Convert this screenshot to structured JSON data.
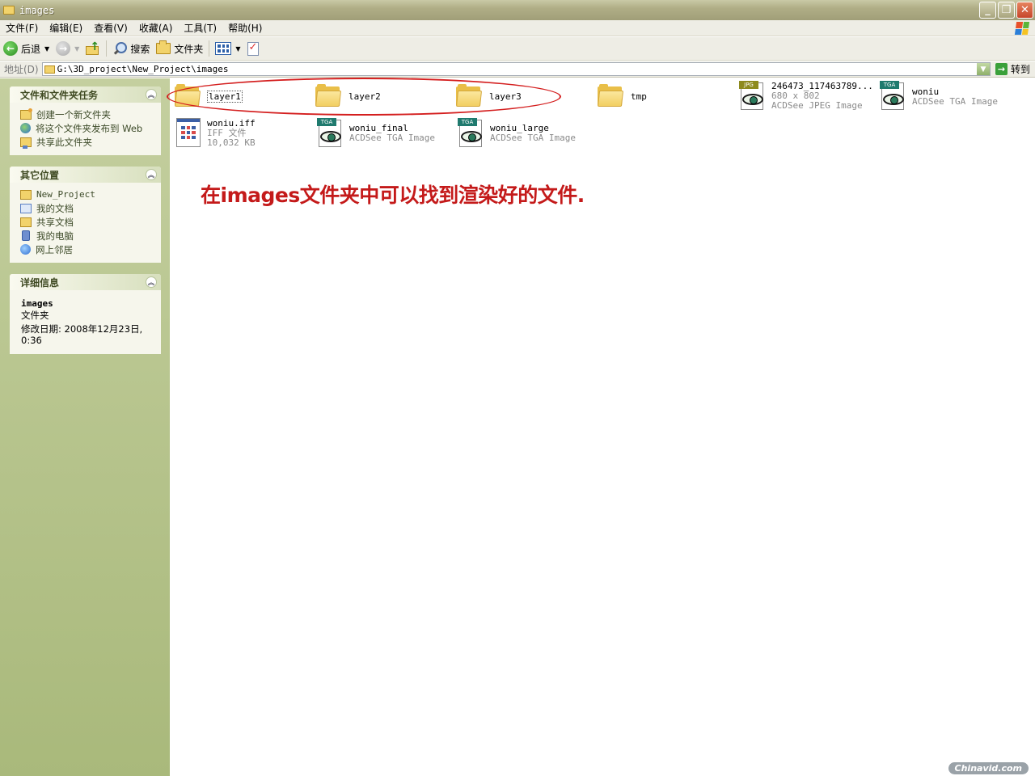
{
  "window": {
    "title": "images"
  },
  "menu": [
    "文件(F)",
    "编辑(E)",
    "查看(V)",
    "收藏(A)",
    "工具(T)",
    "帮助(H)"
  ],
  "toolbar": {
    "back_label": "后退",
    "search_label": "搜索",
    "folders_label": "文件夹"
  },
  "address": {
    "label": "地址(D)",
    "path": "G:\\3D_project\\New_Project\\images",
    "go_label": "转到"
  },
  "tasks_panel": {
    "title": "文件和文件夹任务",
    "items": [
      "创建一个新文件夹",
      "将这个文件夹发布到 Web",
      "共享此文件夹"
    ]
  },
  "places_panel": {
    "title": "其它位置",
    "items": [
      "New_Project",
      "我的文档",
      "共享文档",
      "我的电脑",
      "网上邻居"
    ]
  },
  "details_panel": {
    "title": "详细信息",
    "name": "images",
    "type": "文件夹",
    "modified": "修改日期: 2008年12月23日, 0:36"
  },
  "files": [
    {
      "name": "layer1",
      "kind": "folder"
    },
    {
      "name": "layer2",
      "kind": "folder"
    },
    {
      "name": "layer3",
      "kind": "folder"
    },
    {
      "name": "tmp",
      "kind": "folder"
    },
    {
      "name": "246473_117463789...",
      "line2": "680 x 802",
      "line3": "ACDSee JPEG Image",
      "badge": "JPG"
    },
    {
      "name": "woniu",
      "line2": "ACDSee TGA Image",
      "badge": "TGA"
    },
    {
      "name": "woniu.iff",
      "line2": "IFF 文件",
      "line3": "10,032 KB"
    },
    {
      "name": "woniu_final",
      "line2": "ACDSee TGA Image",
      "badge": "TGA"
    },
    {
      "name": "woniu_large",
      "line2": "ACDSee TGA Image",
      "badge": "TGA"
    }
  ],
  "annotation": "在images文件夹中可以找到渲染好的文件.",
  "watermark": "Chinavid.com",
  "colors": {
    "annotation": "#c41a1a",
    "sidebar": "#b3c18a"
  }
}
